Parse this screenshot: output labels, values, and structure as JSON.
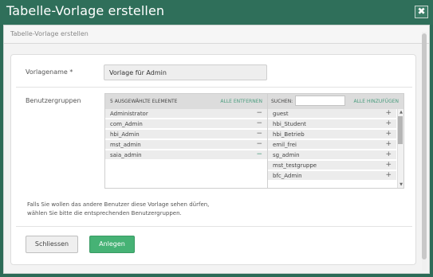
{
  "titlebar": {
    "title": "Tabelle-Vorlage erstellen",
    "close_icon": "✖"
  },
  "subheader": {
    "title": "Tabelle-Vorlage erstellen"
  },
  "form": {
    "name_label": "Vorlagename *",
    "name_value": "Vorlage für Admin",
    "groups_label": "Benutzergruppen"
  },
  "selected": {
    "header": "5 AUSGEWÄHLTE ELEMENTE",
    "remove_all": "ALLE ENTFERNEN",
    "items": [
      "Administrator",
      "com_Admin",
      "hbi_Admin",
      "mst_admin",
      "saia_admin"
    ],
    "op": "−"
  },
  "available": {
    "search_label": "SUCHEN:",
    "add_all": "ALLE HINZUFÜGEN",
    "items": [
      "guest",
      "hbi_Student",
      "hbi_Betrieb",
      "emil_frei",
      "sg_admin",
      "mst_testgruppe",
      "bfc_Admin"
    ],
    "op": "+"
  },
  "help_text": {
    "line1": "Falls Sie wollen das andere Benutzer diese Vorlage sehen dürfen,",
    "line2": "wählen Sie bitte die entsprechenden Benutzergruppen."
  },
  "buttons": {
    "close": "Schliessen",
    "create": "Anlegen"
  }
}
